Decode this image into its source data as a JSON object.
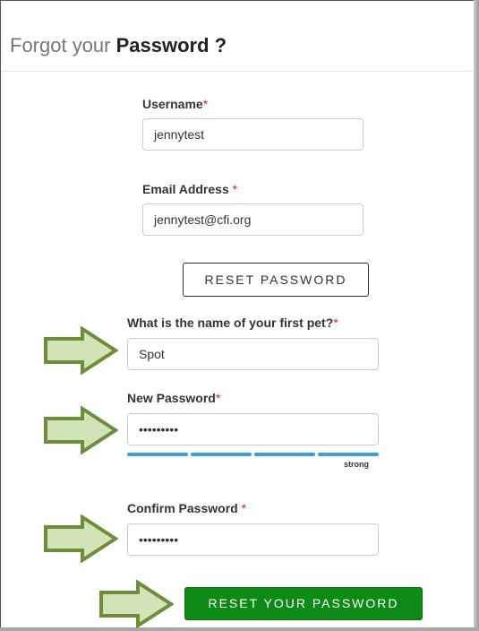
{
  "header": {
    "title_prefix": "Forgot your ",
    "title_bold": "Password ?"
  },
  "form": {
    "username": {
      "label": "Username",
      "required_mark": "*",
      "value": "jennytest"
    },
    "email": {
      "label": "Email Address ",
      "required_mark": "*",
      "value": "jennytest@cfi.org"
    },
    "reset_password_button": "RESET PASSWORD",
    "security_question": {
      "label": "What is the name of your first pet?",
      "required_mark": "*",
      "value": "Spot"
    },
    "new_password": {
      "label": "New Password",
      "required_mark": "*",
      "value": "•••••••••",
      "strength_label": "strong",
      "strength_segments_filled": 4,
      "strength_segments_total": 4
    },
    "confirm_password": {
      "label": "Confirm Password ",
      "required_mark": "*",
      "value": "•••••••••"
    },
    "submit_button": "RESET YOUR PASSWORD"
  },
  "colors": {
    "accent_green": "#0e8a16",
    "strength_blue": "#3aa0dd",
    "required_red": "#d22222",
    "arrow_fill": "#d3e3b8",
    "arrow_stroke": "#6b8e3a"
  },
  "annotations": {
    "arrow_icon": "right-arrow-icon",
    "arrow_count": 4
  }
}
